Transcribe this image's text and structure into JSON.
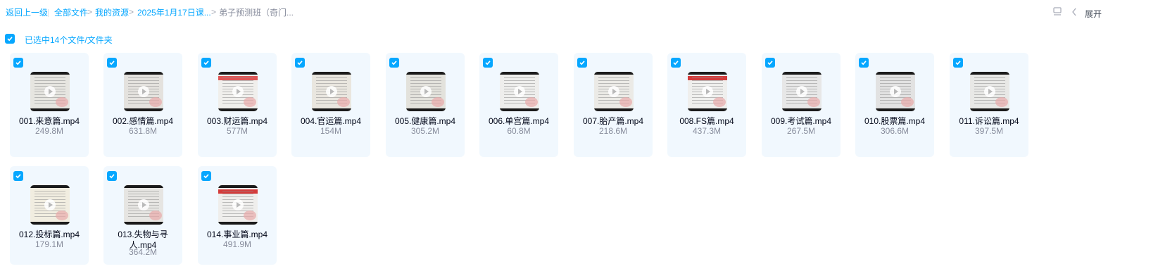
{
  "breadcrumb": {
    "back": "返回上一级",
    "items": [
      "全部文件",
      "我的资源",
      "2025年1月17日课...",
      "弟子预测班（奇门..."
    ]
  },
  "toolbar": {
    "expand_label": "展开"
  },
  "selection": {
    "text": "已选中14个文件/文件夹"
  },
  "files": [
    {
      "name": "001.来意篇.mp4",
      "size": "249.8M"
    },
    {
      "name": "002.感情篇.mp4",
      "size": "631.8M"
    },
    {
      "name": "003.财运篇.mp4",
      "size": "577M"
    },
    {
      "name": "004.官运篇.mp4",
      "size": "154M"
    },
    {
      "name": "005.健康篇.mp4",
      "size": "305.2M"
    },
    {
      "name": "006.单宫篇.mp4",
      "size": "60.8M"
    },
    {
      "name": "007.胎产篇.mp4",
      "size": "218.6M"
    },
    {
      "name": "008.FS篇.mp4",
      "size": "437.3M"
    },
    {
      "name": "009.考试篇.mp4",
      "size": "267.5M"
    },
    {
      "name": "010.股票篇.mp4",
      "size": "306.6M"
    },
    {
      "name": "011.诉讼篇.mp4",
      "size": "397.5M"
    },
    {
      "name": "012.投标篇.mp4",
      "size": "179.1M"
    },
    {
      "name": "013.失物与寻人.mp4",
      "size": "364.2M"
    },
    {
      "name": "014.事业篇.mp4",
      "size": "491.9M"
    }
  ],
  "colors": {
    "accent": "#06a7ff",
    "card_bg": "#f1f8fe"
  },
  "icons": [
    "checkbox-checked-icon",
    "play-icon",
    "list-view-icon",
    "chevron-left-icon"
  ]
}
